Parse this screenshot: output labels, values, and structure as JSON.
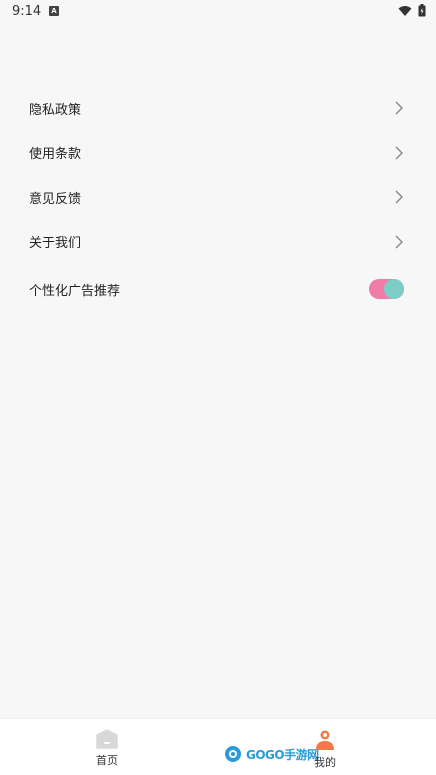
{
  "status_bar": {
    "time": "9:14",
    "app_icon_letter": "A"
  },
  "menu": {
    "items": [
      {
        "label": "隐私政策",
        "icon": "chevron-right-icon"
      },
      {
        "label": "使用条款",
        "icon": "chevron-right-icon"
      },
      {
        "label": "意见反馈",
        "icon": "chevron-right-icon"
      },
      {
        "label": "关于我们",
        "icon": "chevron-right-icon"
      }
    ],
    "toggle_item": {
      "label": "个性化广告推荐",
      "enabled": true
    }
  },
  "tabbar": {
    "home_label": "首页",
    "mine_label": "我的"
  },
  "watermark": {
    "logo_text": "GOGO手游网"
  },
  "colors": {
    "background": "#f7f7f7",
    "toggle_track": "#f07ca8",
    "toggle_knob": "#7ccdc6",
    "mine_icon": "#f07a4a",
    "home_icon": "#d8d8d8",
    "watermark": "#2a9ad8"
  }
}
